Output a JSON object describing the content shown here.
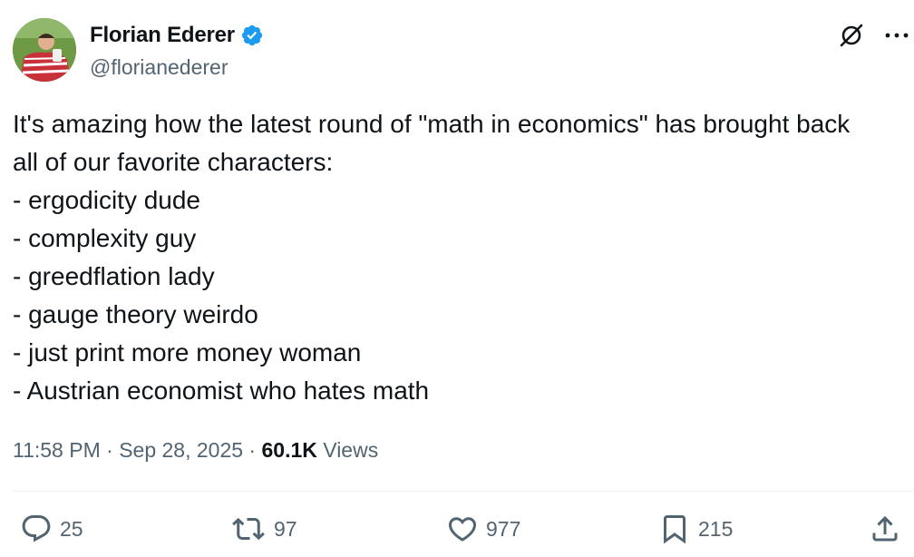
{
  "author": {
    "display_name": "Florian Ederer",
    "handle": "@florianederer",
    "verified": true,
    "verified_color": "#1d9bf0"
  },
  "top_icons": [
    "grok-icon",
    "more-icon"
  ],
  "tweet": {
    "lines": [
      "It's amazing how the latest round of \"math in economics\" has brought back",
      "all of our favorite characters:",
      "- ergodicity dude",
      "- complexity guy",
      "- greedflation lady",
      "- gauge theory weirdo",
      "- just print more money woman",
      "- Austrian economist who hates math"
    ]
  },
  "meta": {
    "time": "11:58 PM",
    "separator": " · ",
    "date": "Sep 28, 2025",
    "views_count": "60.1K",
    "views_label": "Views"
  },
  "actions": {
    "replies": "25",
    "reposts": "97",
    "likes": "977",
    "bookmarks": "215"
  },
  "colors": {
    "text": "#0f1419",
    "secondary": "#536471",
    "divider": "#eff3f4"
  }
}
